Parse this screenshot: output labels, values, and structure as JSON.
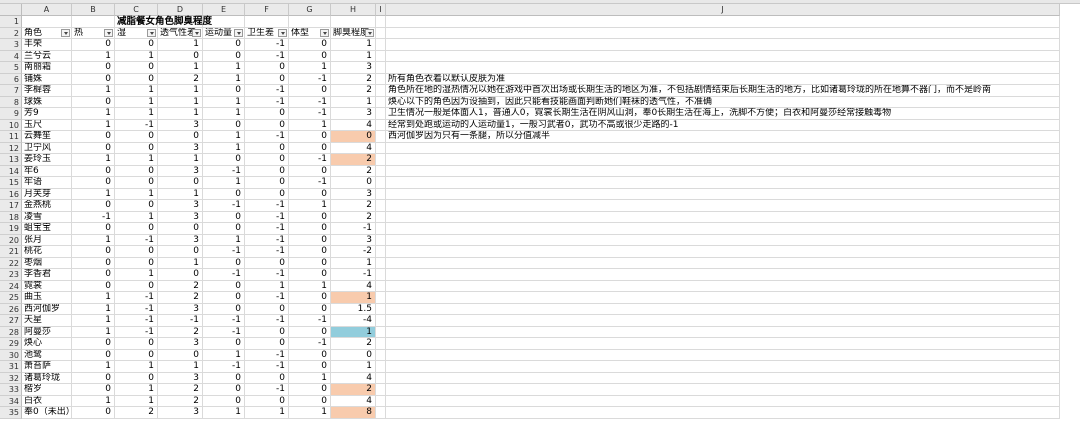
{
  "columns": [
    "A",
    "B",
    "C",
    "D",
    "E",
    "F",
    "G",
    "H",
    "I",
    "J"
  ],
  "title": "减脂餐女角色脚臭程度",
  "headers": [
    "角色",
    "热",
    "湿",
    "透气性差",
    "运动量",
    "卫生差",
    "体型",
    "脚臭程度"
  ],
  "rows": [
    [
      "丰荣",
      "0",
      "0",
      "1",
      "0",
      "-1",
      "0",
      "1"
    ],
    [
      "兰兮云",
      "1",
      "1",
      "0",
      "0",
      "-1",
      "0",
      "1"
    ],
    [
      "南丽霜",
      "0",
      "0",
      "1",
      "1",
      "0",
      "1",
      "3"
    ],
    [
      "铺姝",
      "0",
      "0",
      "2",
      "1",
      "0",
      "-1",
      "2"
    ],
    [
      "李樨蓉",
      "1",
      "1",
      "1",
      "0",
      "-1",
      "0",
      "2"
    ],
    [
      "球姝",
      "0",
      "1",
      "1",
      "1",
      "-1",
      "-1",
      "1"
    ],
    [
      "芳9",
      "1",
      "1",
      "1",
      "1",
      "0",
      "-1",
      "3"
    ],
    [
      "玉尺",
      "1",
      "-1",
      "3",
      "0",
      "0",
      "1",
      "4"
    ],
    [
      "云舞笙",
      "0",
      "0",
      "0",
      "1",
      "-1",
      "0",
      "0"
    ],
    [
      "卫宁风",
      "0",
      "0",
      "3",
      "1",
      "0",
      "0",
      "4"
    ],
    [
      "姜玲玉",
      "1",
      "1",
      "1",
      "0",
      "0",
      "-1",
      "2"
    ],
    [
      "牢6",
      "0",
      "0",
      "3",
      "-1",
      "0",
      "0",
      "2"
    ],
    [
      "牢语",
      "0",
      "0",
      "0",
      "1",
      "0",
      "-1",
      "0"
    ],
    [
      "月芙芽",
      "1",
      "1",
      "1",
      "0",
      "0",
      "0",
      "3"
    ],
    [
      "金燕桃",
      "0",
      "0",
      "3",
      "-1",
      "-1",
      "1",
      "2"
    ],
    [
      "凌雪",
      "-1",
      "1",
      "3",
      "0",
      "-1",
      "0",
      "2"
    ],
    [
      "蛆宝宝",
      "0",
      "0",
      "0",
      "0",
      "-1",
      "0",
      "-1"
    ],
    [
      "张月",
      "1",
      "-1",
      "3",
      "1",
      "-1",
      "0",
      "3"
    ],
    [
      "桃花",
      "0",
      "0",
      "0",
      "-1",
      "-1",
      "0",
      "-2"
    ],
    [
      "枣烟",
      "0",
      "0",
      "1",
      "0",
      "0",
      "0",
      "1"
    ],
    [
      "李香君",
      "0",
      "1",
      "0",
      "-1",
      "-1",
      "0",
      "-1"
    ],
    [
      "霓裳",
      "0",
      "0",
      "2",
      "0",
      "1",
      "1",
      "4"
    ],
    [
      "曲玉",
      "1",
      "-1",
      "2",
      "0",
      "-1",
      "0",
      "1"
    ],
    [
      "西河伽罗",
      "1",
      "-1",
      "3",
      "0",
      "0",
      "0",
      "1.5"
    ],
    [
      "天星",
      "1",
      "-1",
      "-1",
      "-1",
      "-1",
      "-1",
      "-4"
    ],
    [
      "阿曼莎",
      "1",
      "-1",
      "2",
      "-1",
      "0",
      "0",
      "1"
    ],
    [
      "焕心",
      "0",
      "0",
      "3",
      "0",
      "0",
      "-1",
      "2"
    ],
    [
      "池鹭",
      "0",
      "0",
      "0",
      "1",
      "-1",
      "0",
      "0"
    ],
    [
      "萧苔萨",
      "1",
      "1",
      "1",
      "-1",
      "-1",
      "0",
      "1"
    ],
    [
      "诸葛玲珑",
      "0",
      "0",
      "3",
      "0",
      "0",
      "1",
      "4"
    ],
    [
      "楷岁",
      "0",
      "1",
      "2",
      "0",
      "-1",
      "0",
      "2"
    ],
    [
      "白衣",
      "1",
      "1",
      "2",
      "0",
      "0",
      "0",
      "4"
    ],
    [
      "奉0（未出）",
      "0",
      "2",
      "3",
      "1",
      "1",
      "1",
      "8"
    ]
  ],
  "notes": [
    "所有角色衣着以默认皮肤为准",
    "角色所在地的湿热情况以她在游戏中首次出场或长期生活的地区为准，不包括剧情结束后长期生活的地方，比如诸葛玲珑的所在地算不器门，而不是岭南",
    "焕心以下的角色因为设抽到，因此只能看技能画面判断她们鞋袜的透气性，不准确",
    "卫生情况一般是体面人1，普通人0，霓裳长期生活在阴风山洞，奉0长期生活在海上，洗脚不方便；白衣和阿曼莎经常接触毒物",
    "经常到处跑或运动的人运动量1，一般习武者0，武功不高或很少走路的-1",
    "西河伽罗因为只有一条腿，所以分值减半"
  ],
  "colors": {
    "orange": "#f8cbad",
    "blue": "#92cddc",
    "red": "#ff0000"
  },
  "highlights": {
    "8": "orange",
    "10": "orange",
    "22": "orange",
    "25": "blue",
    "30": "orange",
    "32": "orange",
    "33": "red"
  }
}
